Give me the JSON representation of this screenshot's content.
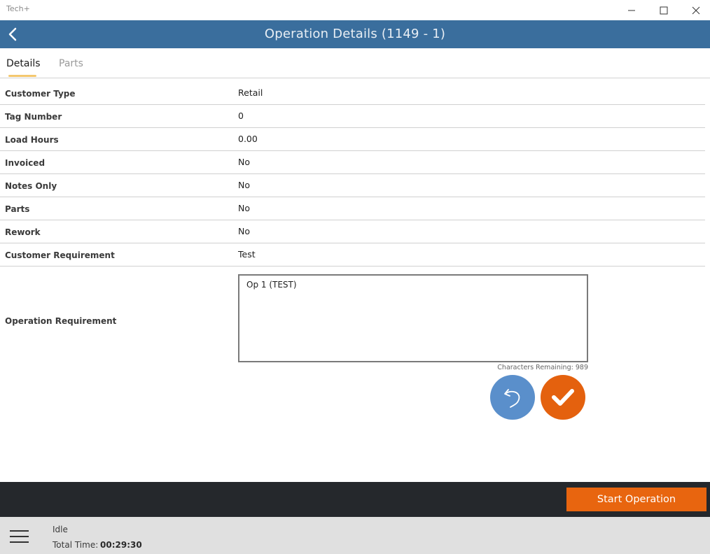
{
  "window": {
    "app_title": "Tech+",
    "controls": [
      "minimize-icon",
      "maximize-icon",
      "close-icon"
    ]
  },
  "header": {
    "title": "Operation Details (1149 - 1)",
    "back_icon": "chevron-left-icon",
    "background": "#3a6e9d"
  },
  "tabs": [
    {
      "label": "Details",
      "active": true
    },
    {
      "label": "Parts",
      "active": false
    }
  ],
  "details": [
    {
      "label": "Customer Type",
      "value": "Retail"
    },
    {
      "label": "Tag Number",
      "value": "0"
    },
    {
      "label": "Load Hours",
      "value": "0.00"
    },
    {
      "label": "Invoiced",
      "value": "No"
    },
    {
      "label": "Notes Only",
      "value": "No"
    },
    {
      "label": "Parts",
      "value": "No"
    },
    {
      "label": "Rework",
      "value": "No"
    },
    {
      "label": "Customer Requirement",
      "value": "Test"
    }
  ],
  "operation_requirement": {
    "label": "Operation Requirement",
    "value": "Op 1 (TEST)",
    "chars_remaining_label": "Characters Remaining:",
    "chars_remaining": "989"
  },
  "buttons": {
    "undo_icon": "undo-icon",
    "confirm_icon": "checkmark-icon",
    "undo_color": "#5a8fcb",
    "confirm_color": "#e4610e"
  },
  "action_bar": {
    "start_label": "Start Operation",
    "accent": "#e8650f"
  },
  "status_bar": {
    "menu_icon": "hamburger-menu-icon",
    "status": "Idle",
    "total_time_label": "Total Time:",
    "total_time": "00:29:30"
  }
}
